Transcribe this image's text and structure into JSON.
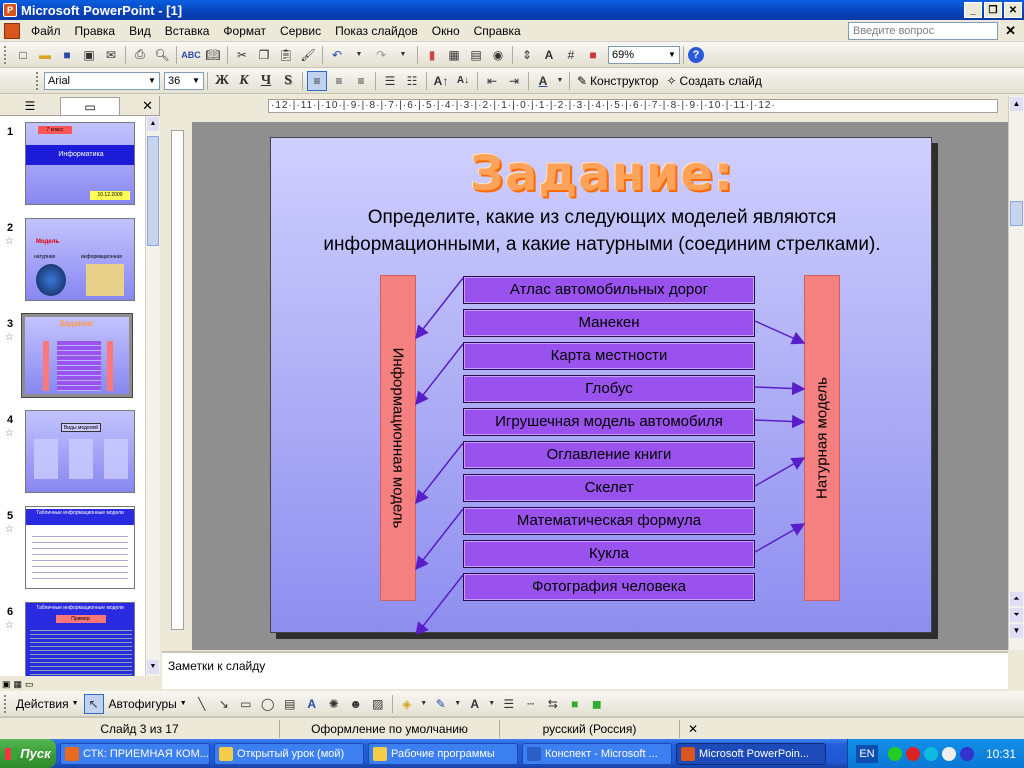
{
  "window": {
    "title": "Microsoft PowerPoint - [1]",
    "minimize": "_",
    "restore": "❐",
    "close": "✕"
  },
  "menu": {
    "items": [
      "Файл",
      "Правка",
      "Вид",
      "Вставка",
      "Формат",
      "Сервис",
      "Показ слайдов",
      "Окно",
      "Справка"
    ],
    "help_placeholder": "Введите вопрос",
    "close": "✕"
  },
  "standard_toolbar": {
    "zoom": "69%"
  },
  "format_toolbar": {
    "font": "Arial",
    "size": "36",
    "bold": "Ж",
    "italic": "К",
    "underline": "Ч",
    "shadow": "S",
    "designer": "Конструктор",
    "new_slide": "Создать слайд"
  },
  "left_pane": {
    "close": "✕",
    "slides": [
      {
        "num": "1",
        "title": "Информатика",
        "tag": "7 класс",
        "date": "10.12.2009"
      },
      {
        "num": "2",
        "title": "Модель",
        "a": "натурная",
        "b": "информационная"
      },
      {
        "num": "3",
        "title": "Задание:"
      },
      {
        "num": "4",
        "title": "Виды моделей"
      },
      {
        "num": "5",
        "title": "Табличные информационные модели"
      },
      {
        "num": "6",
        "title": "Табличные информационные модели",
        "tag": "Пример:"
      }
    ]
  },
  "ruler": {
    "horizontal": "·12·|·11·|·10·|·9·|·8·|·7·|·6·|·5·|·4·|·3·|·2·|·1·|·0·|·1·|·2·|·3·|·4·|·5·|·6·|·7·|·8·|·9·|·10·|·11·|·12·"
  },
  "slide": {
    "title": "Задание:",
    "subtitle_line1": "Определите, какие из следующих моделей являются",
    "subtitle_line2": "информационными, а какие натурными (соединим стрелками).",
    "left_label": "Информационная модель",
    "right_label": "Натурная модель",
    "models": [
      {
        "label": "Атлас автомобильных дорог",
        "target": "info"
      },
      {
        "label": "Манекен",
        "target": "natural"
      },
      {
        "label": "Карта местности",
        "target": "info"
      },
      {
        "label": "Глобус",
        "target": "natural"
      },
      {
        "label": "Игрушечная модель автомобиля",
        "target": "natural"
      },
      {
        "label": "Оглавление книги",
        "target": "info"
      },
      {
        "label": "Скелет",
        "target": "natural"
      },
      {
        "label": "Математическая формула",
        "target": "info"
      },
      {
        "label": "Кукла",
        "target": "natural"
      },
      {
        "label": "Фотография человека",
        "target": "info"
      }
    ]
  },
  "notes": {
    "placeholder": "Заметки к слайду"
  },
  "draw_toolbar": {
    "actions": "Действия",
    "autoshapes": "Автофигуры"
  },
  "status": {
    "slide": "Слайд 3 из 17",
    "design": "Оформление по умолчанию",
    "language": "русский (Россия)"
  },
  "taskbar": {
    "start": "Пуск",
    "tasks": [
      {
        "label": "СТК: ПРИЕМНАЯ КОМ...",
        "color": "#e86a1a"
      },
      {
        "label": "Открытый урок (мой)",
        "color": "#f4cc46"
      },
      {
        "label": "Рабочие программы",
        "color": "#f4cc46"
      },
      {
        "label": "Конспект - Microsoft ...",
        "color": "#2b5fc8"
      },
      {
        "label": "Microsoft PowerPoin...",
        "color": "#d8551e",
        "active": true
      }
    ],
    "lang": "EN",
    "clock": "10:31"
  }
}
